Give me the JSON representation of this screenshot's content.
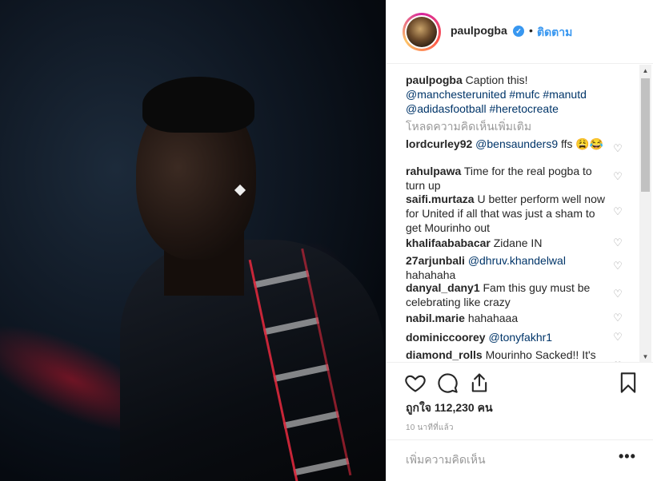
{
  "post": {
    "username": "paulpogba",
    "verified_icon": "verified-badge-icon",
    "dot": "•",
    "follow_label": "ติดตาม",
    "caption": {
      "username": "paulpogba",
      "text": "Caption this!",
      "tags_line1": "@manchesterunited #mufc #manutd",
      "tags_line2": "@adidasfootball #heretocreate"
    },
    "load_more": "โหลดความคิดเห็นเพิ่มเติม",
    "comments": [
      {
        "user": "lordcurley92",
        "mention": "@bensaunders9",
        "text": " ffs 😩😂"
      },
      {
        "user": "rahulpawa",
        "mention": "",
        "text": "Time for the real pogba to turn up"
      },
      {
        "user": "saifi.murtaza",
        "mention": "",
        "text": "U better perform well now for United if all that was just a sham to get Mourinho out"
      },
      {
        "user": "khalifaababacar",
        "mention": "",
        "text": "Zidane IN"
      },
      {
        "user": "27arjunbali",
        "mention": "@dhruv.khandelwal",
        "text": " hahahaha"
      },
      {
        "user": "danyal_dany1",
        "mention": "",
        "text": "Fam this guy must be celebrating like crazy"
      },
      {
        "user": "nabil.marie",
        "mention": "",
        "text": "hahahaaa"
      },
      {
        "user": "dominiccoorey",
        "mention": "@tonyfakhr1",
        "text": ""
      },
      {
        "user": "diamond_rolls",
        "mention": "",
        "text": "Mourinho Sacked!! It's"
      }
    ],
    "likes": "ถูกใจ 112,230 คน",
    "time": "10 นาทีที่แล้ว",
    "add_comment_placeholder": "เพิ่มความคิดเห็น",
    "more_label": "•••"
  },
  "colors": {
    "link": "#003569",
    "follow": "#3897f0",
    "muted": "#999999",
    "text": "#262626"
  }
}
